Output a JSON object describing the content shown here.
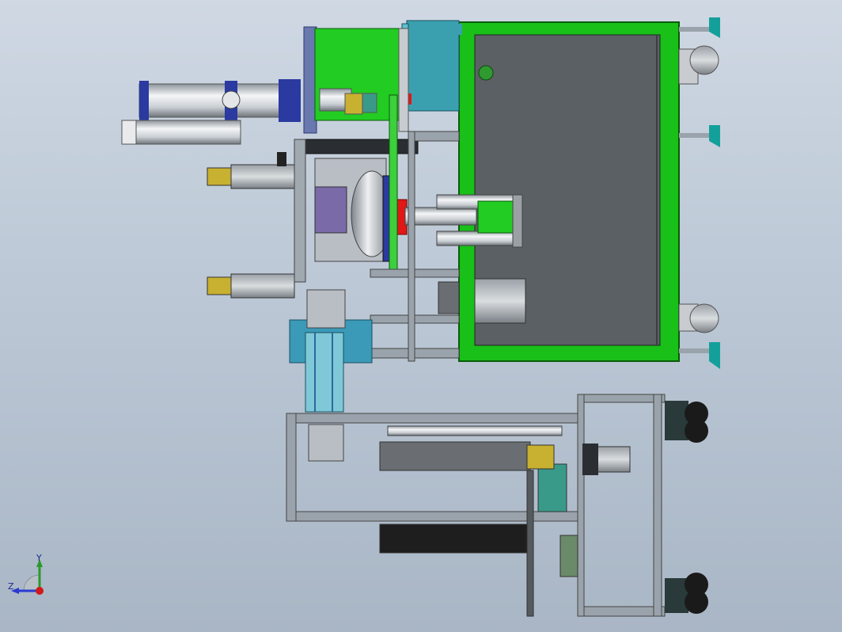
{
  "viewport": {
    "background_top": "#cfd8e3",
    "background_bottom": "#a9b6c5"
  },
  "colors": {
    "frame_green": "#18c018",
    "panel_dark": "#555a5e",
    "teal": "#3aa0b0",
    "navy": "#2a3aa0",
    "red": "#e01818",
    "steel": "#c8ccd0",
    "profile": "#9aa3ab"
  },
  "triad": {
    "y_label": "Y",
    "z_label": "Z",
    "icon": "axis-triad-icon"
  }
}
